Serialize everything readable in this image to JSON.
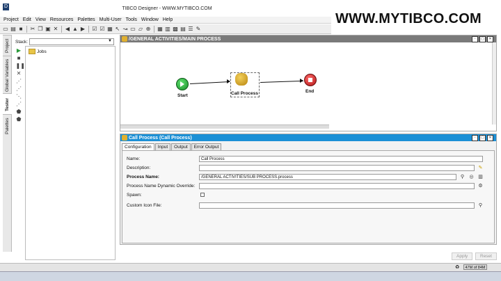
{
  "window": {
    "title": "TIBCO Designer - WWW.MYTIBCO.COM",
    "watermark": "WWW.MYTIBCO.COM",
    "logo": "D"
  },
  "menu": [
    "Project",
    "Edit",
    "View",
    "Resources",
    "Palettes",
    "Multi-User",
    "Tools",
    "Window",
    "Help"
  ],
  "left_tabs": [
    "Project",
    "Global Variables",
    "Tester",
    "Palettes"
  ],
  "stack": {
    "label": "Stack:",
    "value": ""
  },
  "tree": {
    "root": "Jobs"
  },
  "canvas": {
    "path": "/GENERAL ACTIVITIES/MAIN PROCESS",
    "nodes": {
      "start": "Start",
      "call": "Call Process",
      "end": "End"
    }
  },
  "properties": {
    "title": "Call Process (Call Process)",
    "tabs": [
      "Configuration",
      "Input",
      "Output",
      "Error Output"
    ],
    "fields": {
      "name": {
        "label": "Name:",
        "value": "Call Process"
      },
      "description": {
        "label": "Description:",
        "value": ""
      },
      "process_name": {
        "label": "Process Name:",
        "value": "/GENERAL ACTIVITIES/SUB PROCESS.process"
      },
      "dynamic_override": {
        "label": "Process Name Dynamic Override:",
        "value": ""
      },
      "spawn": {
        "label": "Spawn:",
        "checked": false
      },
      "custom_icon": {
        "label": "Custom Icon File:",
        "value": ""
      }
    },
    "buttons": {
      "apply": "Apply",
      "reset": "Reset"
    }
  },
  "status": {
    "memory": "47M of 84M"
  },
  "colors": {
    "accent_blue": "#1c90d6",
    "header_gray": "#7a7a7a"
  }
}
